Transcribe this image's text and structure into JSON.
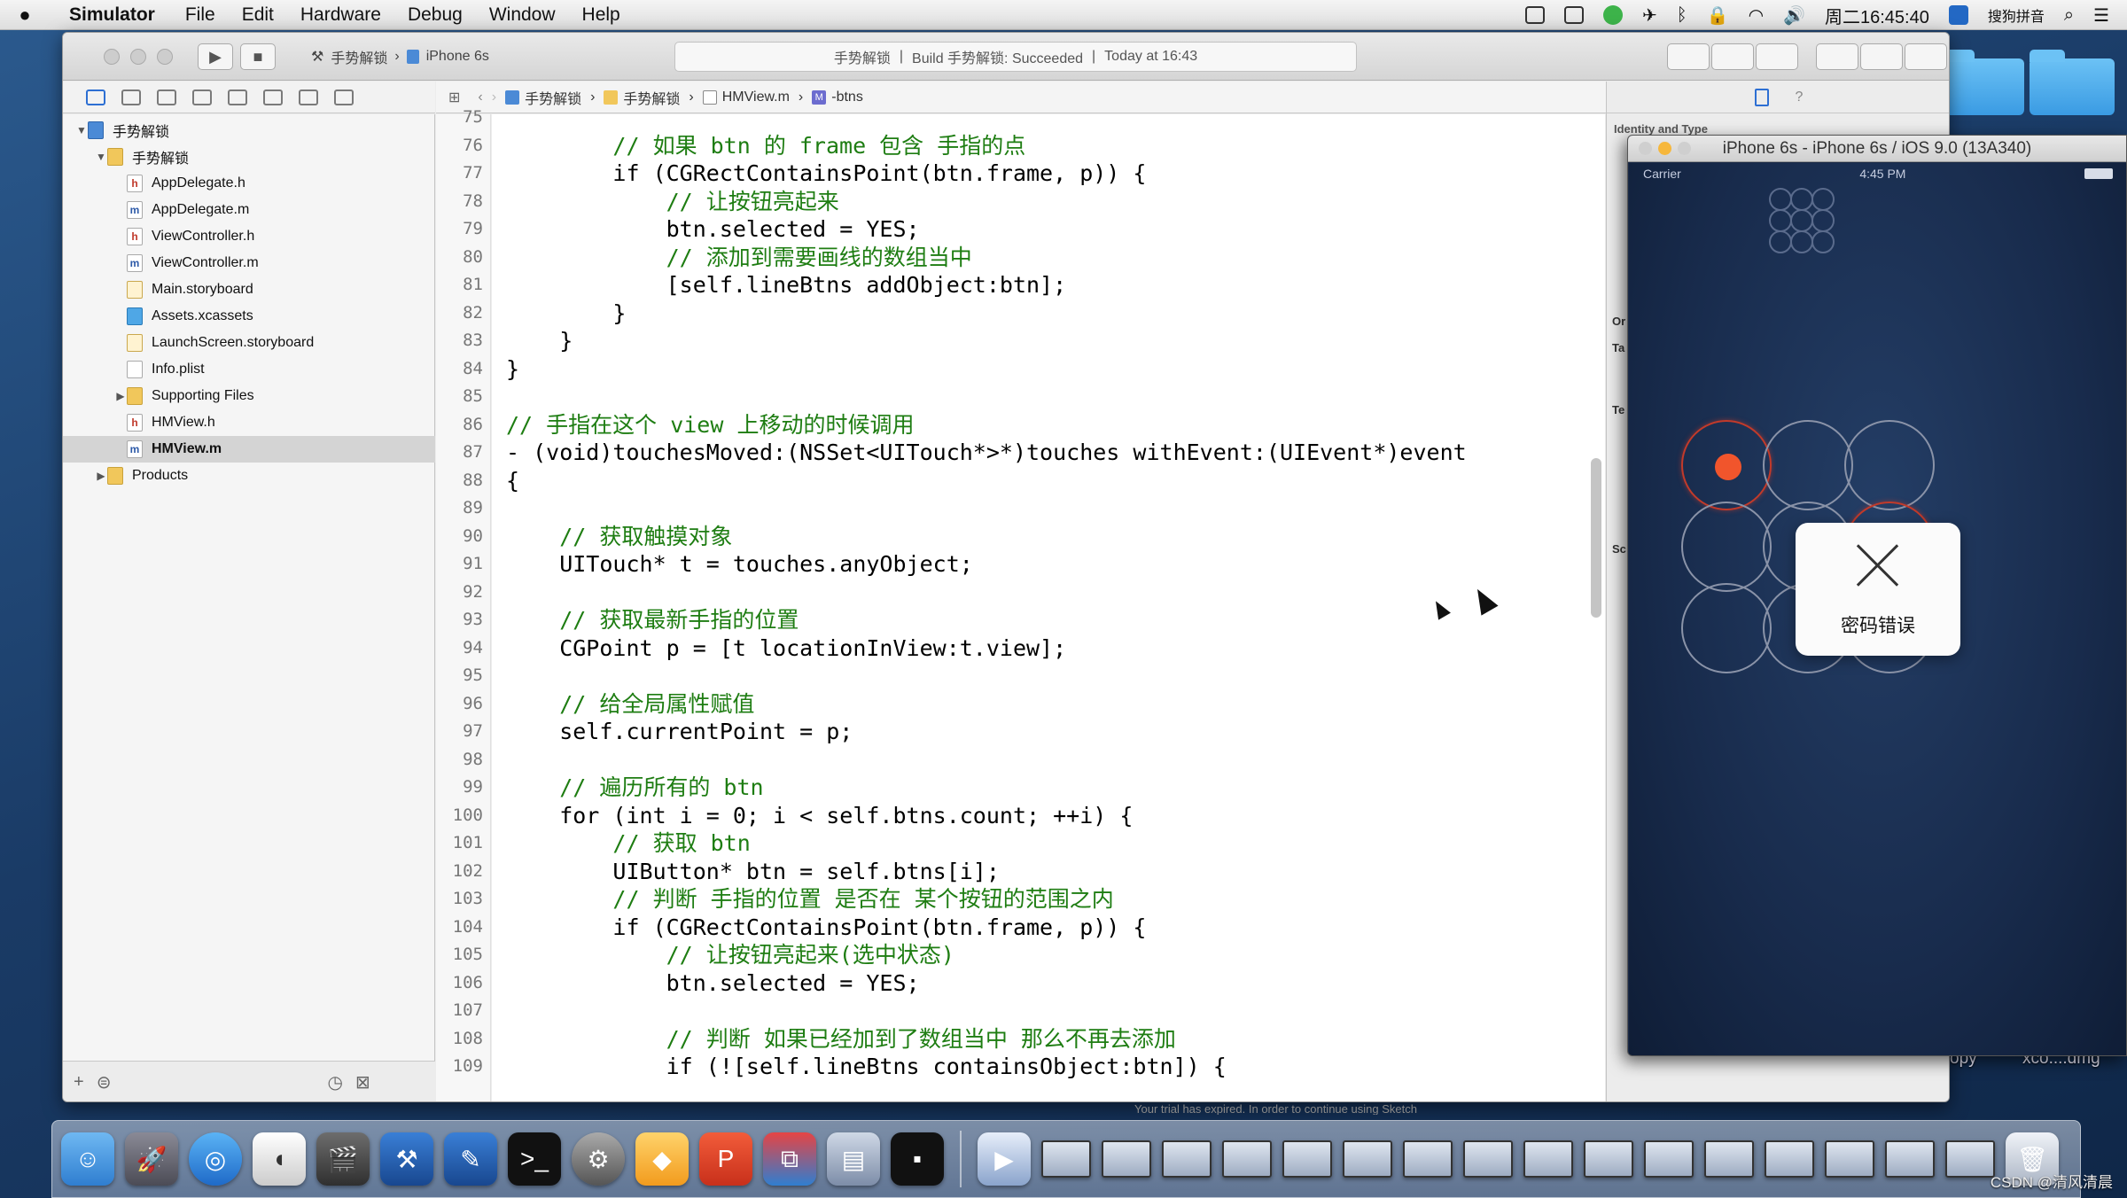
{
  "menubar": {
    "app_name": "Simulator",
    "menus": [
      "File",
      "Edit",
      "Hardware",
      "Debug",
      "Window",
      "Help"
    ],
    "clock": "周二16:45:40",
    "input_method": "搜狗拼音"
  },
  "xcode": {
    "scheme_project": "手势解锁",
    "scheme_device": "iPhone 6s",
    "status_project": "手势解锁",
    "status_build": "Build 手势解锁: Succeeded",
    "status_time": "Today at 16:43"
  },
  "navigator": {
    "items": [
      {
        "label": "手势解锁",
        "icon": "proj",
        "indent": 0,
        "disc": "▼"
      },
      {
        "label": "手势解锁",
        "icon": "folder-y",
        "indent": 1,
        "disc": "▼"
      },
      {
        "label": "AppDelegate.h",
        "icon": "h",
        "indent": 2,
        "disc": ""
      },
      {
        "label": "AppDelegate.m",
        "icon": "m",
        "indent": 2,
        "disc": ""
      },
      {
        "label": "ViewController.h",
        "icon": "h",
        "indent": 2,
        "disc": ""
      },
      {
        "label": "ViewController.m",
        "icon": "m",
        "indent": 2,
        "disc": ""
      },
      {
        "label": "Main.storyboard",
        "icon": "sb",
        "indent": 2,
        "disc": ""
      },
      {
        "label": "Assets.xcassets",
        "icon": "asset",
        "indent": 2,
        "disc": ""
      },
      {
        "label": "LaunchScreen.storyboard",
        "icon": "sb",
        "indent": 2,
        "disc": ""
      },
      {
        "label": "Info.plist",
        "icon": "plist",
        "indent": 2,
        "disc": ""
      },
      {
        "label": "Supporting Files",
        "icon": "folder-y",
        "indent": 2,
        "disc": "▶"
      },
      {
        "label": "HMView.h",
        "icon": "h",
        "indent": 2,
        "disc": ""
      },
      {
        "label": "HMView.m",
        "icon": "m",
        "indent": 2,
        "disc": "",
        "selected": true
      },
      {
        "label": "Products",
        "icon": "folder-y",
        "indent": 1,
        "disc": "▶"
      }
    ]
  },
  "jumpbar": {
    "crumbs": [
      "手势解锁",
      "手势解锁",
      "HMView.m",
      "-btns"
    ]
  },
  "editor": {
    "lines": [
      {
        "n": "75",
        "t": "",
        "c": false
      },
      {
        "n": "76",
        "t": "        // 如果 btn 的 frame 包含 手指的点",
        "c": true
      },
      {
        "n": "77",
        "t": "        if (CGRectContainsPoint(btn.frame, p)) {",
        "c": false
      },
      {
        "n": "78",
        "t": "            // 让按钮亮起来",
        "c": true
      },
      {
        "n": "79",
        "t": "            btn.selected = YES;",
        "c": false
      },
      {
        "n": "80",
        "t": "            // 添加到需要画线的数组当中",
        "c": true
      },
      {
        "n": "81",
        "t": "            [self.lineBtns addObject:btn];",
        "c": false
      },
      {
        "n": "82",
        "t": "        }",
        "c": false
      },
      {
        "n": "83",
        "t": "    }",
        "c": false
      },
      {
        "n": "84",
        "t": "}",
        "c": false
      },
      {
        "n": "85",
        "t": "",
        "c": false
      },
      {
        "n": "86",
        "t": "// 手指在这个 view 上移动的时候调用",
        "c": true
      },
      {
        "n": "87",
        "t": "- (void)touchesMoved:(NSSet<UITouch*>*)touches withEvent:(UIEvent*)event",
        "c": false
      },
      {
        "n": "88",
        "t": "{",
        "c": false
      },
      {
        "n": "89",
        "t": "",
        "c": false
      },
      {
        "n": "90",
        "t": "    // 获取触摸对象",
        "c": true
      },
      {
        "n": "91",
        "t": "    UITouch* t = touches.anyObject;",
        "c": false
      },
      {
        "n": "92",
        "t": "",
        "c": false
      },
      {
        "n": "93",
        "t": "    // 获取最新手指的位置",
        "c": true
      },
      {
        "n": "94",
        "t": "    CGPoint p = [t locationInView:t.view];",
        "c": false
      },
      {
        "n": "95",
        "t": "",
        "c": false
      },
      {
        "n": "96",
        "t": "    // 给全局属性赋值",
        "c": true
      },
      {
        "n": "97",
        "t": "    self.currentPoint = p;",
        "c": false
      },
      {
        "n": "98",
        "t": "",
        "c": false
      },
      {
        "n": "99",
        "t": "    // 遍历所有的 btn",
        "c": true
      },
      {
        "n": "100",
        "t": "    for (int i = 0; i < self.btns.count; ++i) {",
        "c": false
      },
      {
        "n": "101",
        "t": "        // 获取 btn",
        "c": true
      },
      {
        "n": "102",
        "t": "        UIButton* btn = self.btns[i];",
        "c": false
      },
      {
        "n": "103",
        "t": "        // 判断 手指的位置 是否在 某个按钮的范围之内",
        "c": true
      },
      {
        "n": "104",
        "t": "        if (CGRectContainsPoint(btn.frame, p)) {",
        "c": false
      },
      {
        "n": "105",
        "t": "            // 让按钮亮起来(选中状态)",
        "c": true
      },
      {
        "n": "106",
        "t": "            btn.selected = YES;",
        "c": false
      },
      {
        "n": "107",
        "t": "",
        "c": false
      },
      {
        "n": "108",
        "t": "            // 判断 如果已经加到了数组当中 那么不再去添加",
        "c": true
      },
      {
        "n": "109",
        "t": "            if (![self.lineBtns containsObject:btn]) {",
        "c": false
      }
    ]
  },
  "inspector": {
    "title": "Identity and Type",
    "labels": [
      "Or",
      "Ta",
      "Te",
      "Sc"
    ]
  },
  "simulator": {
    "title": "iPhone 6s - iPhone 6s / iOS 9.0 (13A340)",
    "carrier": "Carrier",
    "time": "4:45 PM",
    "alert_message": "密码错误",
    "error_buttons": [
      0,
      5
    ]
  },
  "desktop": {
    "labels": [
      "opy",
      "xco....dmg"
    ]
  },
  "trialbar": "Your trial has expired. In order to continue using Sketch",
  "watermark": "CSDN @清风清晨",
  "colors": {
    "comment": "#1e7d12",
    "error_ring": "#c23a2a",
    "error_dot": "#f1552c"
  }
}
